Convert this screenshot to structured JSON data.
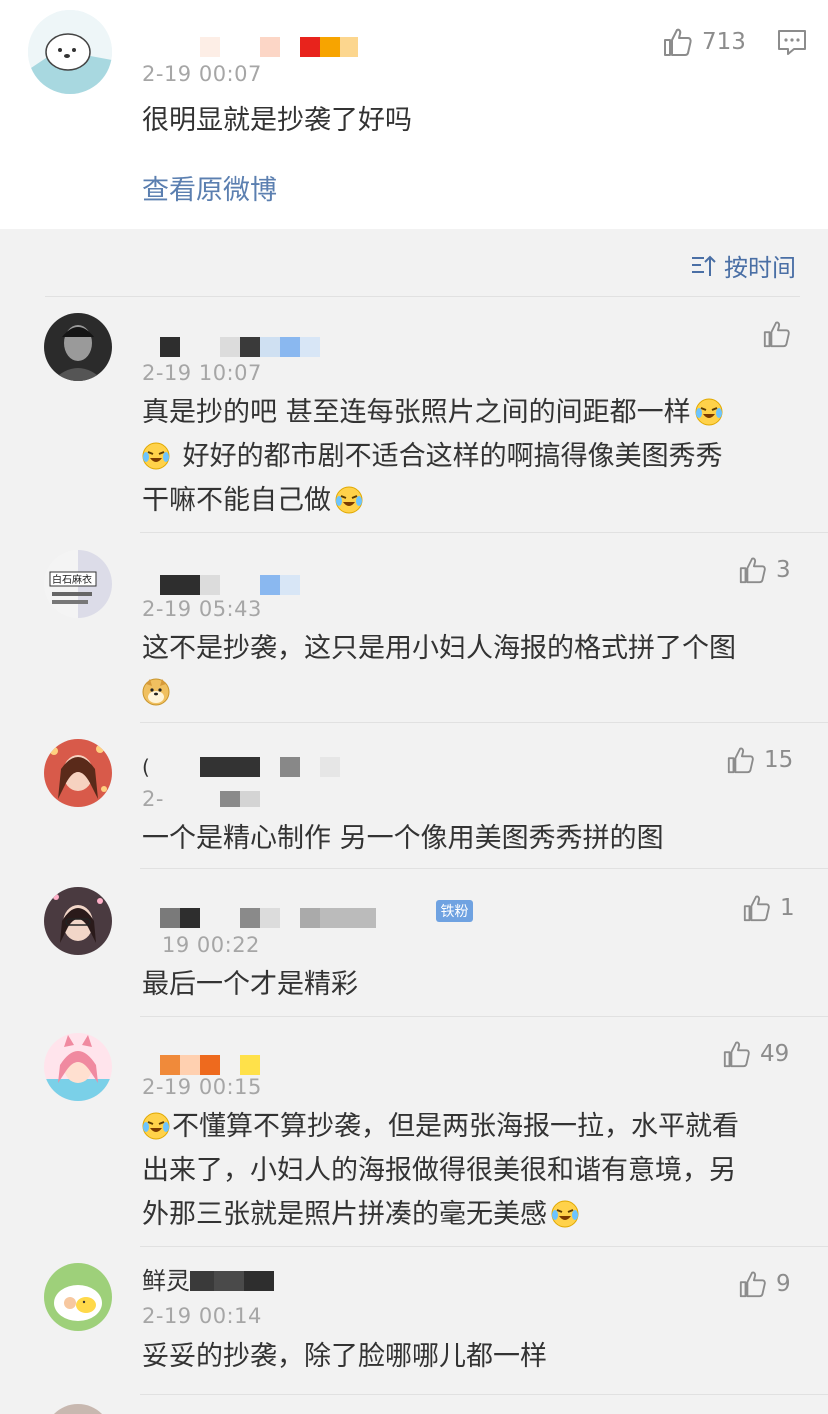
{
  "post": {
    "time": "2-19 00:07",
    "likes": "713",
    "text": "很明显就是抄袭了好吗",
    "view_original": "查看原微博"
  },
  "sort": {
    "label": "按时间"
  },
  "comments": [
    {
      "time": "2-19 10:07",
      "likes": "",
      "line1": "真是抄的吧 甚至连每张照片之间的间距都一样",
      "line2": "好好的都市剧不适合这样的啊搞得像美图秀秀",
      "line3": "干嘛不能自己做"
    },
    {
      "time": "2-19 05:43",
      "likes": "3",
      "line1": "这不是抄袭，这只是用小妇人海报的格式拼了个图",
      "avatar_text": "白石麻衣"
    },
    {
      "time_visible": "2-",
      "likes": "15",
      "line1": "一个是精心制作 另一个像用美图秀秀拼的图"
    },
    {
      "time_visible": "19 00:22",
      "likes": "1",
      "badge": "铁粉",
      "line1": "最后一个才是精彩"
    },
    {
      "time": "2-19 00:15",
      "likes": "49",
      "line1": "不懂算不算抄袭，但是两张海报一拉，水平就看",
      "line2": "出来了，小妇人的海报做得很美很和谐有意境，另",
      "line3": "外那三张就是照片拼凑的毫无美感"
    },
    {
      "name_visible": "鲜灵",
      "time": "2-19 00:14",
      "likes": "9",
      "line1": "妥妥的抄袭，除了脸哪哪儿都一样"
    }
  ],
  "colors": {
    "link": "#5b7fb0",
    "timestamp": "#a6a6a6",
    "badge": "#6fa2e1"
  },
  "icons": {
    "like": "thumbs-up-icon",
    "comment": "comment-icon",
    "sort": "sort-icon",
    "laugh": "laugh-cry-emoji",
    "doge": "doge-emoji"
  }
}
